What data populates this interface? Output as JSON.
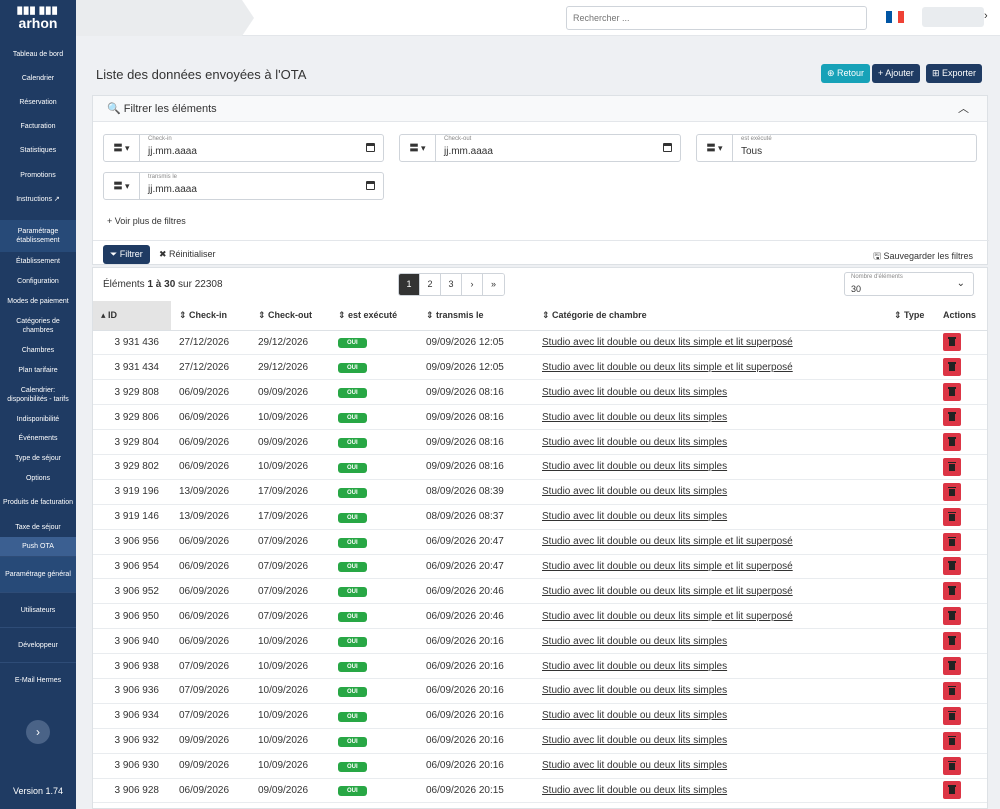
{
  "sidebar": {
    "logo_mark": "▉▉▉ ▉▉▉",
    "logo_name": "arhon",
    "items": [
      {
        "label": "Tableau de bord"
      },
      {
        "label": "Calendrier"
      },
      {
        "label": "Réservation"
      },
      {
        "label": "Facturation"
      },
      {
        "label": "Statistiques"
      },
      {
        "label": "Promotions"
      },
      {
        "label": "Instructions ↗"
      },
      {
        "label": "Paramétrage établissement"
      },
      {
        "label": "Établissement"
      },
      {
        "label": "Configuration"
      },
      {
        "label": "Modes de paiement"
      },
      {
        "label": "Catégories de chambres"
      },
      {
        "label": "Chambres"
      },
      {
        "label": "Plan tarifaire"
      },
      {
        "label": "Calendrier: disponibilités - tarifs"
      },
      {
        "label": "Indisponibilité"
      },
      {
        "label": "Événements"
      },
      {
        "label": "Type de séjour"
      },
      {
        "label": "Options"
      },
      {
        "label": "Produits de facturation"
      },
      {
        "label": "Taxe de séjour"
      },
      {
        "label": "Push OTA"
      },
      {
        "label": "Paramétrage général"
      },
      {
        "label": "Utilisateurs"
      },
      {
        "label": "Développeur"
      },
      {
        "label": "E-Mail Hermes"
      }
    ],
    "collapse_icon": "›",
    "version": "Version 1.74"
  },
  "topbar": {
    "search_placeholder": "Rechercher ...",
    "flag_colors": [
      "#0055a4",
      "#ffffff",
      "#ef4135"
    ],
    "chevron": "›"
  },
  "page": {
    "title": "Liste des données envoyées à l'OTA",
    "btn_retour": "⊕ Retour",
    "btn_ajouter": "+ Ajouter",
    "btn_exporter": "⊞ Exporter"
  },
  "filters": {
    "title": "🔍  Filtrer les éléments",
    "collapse": "︿",
    "op": "〓 ▾",
    "checkin_label": "Check-in",
    "checkin_value": "jj.mm.aaaa",
    "checkout_label": "Check-out",
    "checkout_value": "jj.mm.aaaa",
    "executed_label": "est exécuté",
    "executed_value": "Tous",
    "sent_label": "transmis le",
    "sent_value": "jj.mm.aaaa",
    "more": "+   Voir plus de filtres",
    "btn_filter": "⏷ Filtrer",
    "btn_reset": "✖ Réinitialiser",
    "btn_save": "🖫 Sauvegarder les filtres"
  },
  "table": {
    "count_prefix": "Éléments ",
    "count_range": "1 à 30",
    "count_suffix": " sur 22308",
    "pages": [
      "1",
      "2",
      "3",
      "›",
      "»"
    ],
    "page_size_label": "Nombre d'éléments",
    "page_size_value": "30",
    "page_size_chevron": "⌄",
    "headers": {
      "id": "▴ ID",
      "checkin": "⇕ Check-in",
      "checkout": "⇕ Check-out",
      "executed": "⇕ est exécuté",
      "sent": "⇕ transmis le",
      "category": "⇕ Catégorie de chambre",
      "type": "⇕ Type",
      "actions": "Actions"
    },
    "rows": [
      {
        "id": "3 931 436",
        "checkin": "27/12/2026",
        "checkout": "29/12/2026",
        "executed": "OUI",
        "sent": "09/09/2026 12:05",
        "category": "Studio avec lit double ou deux lits simple et lit superposé",
        "type": ""
      },
      {
        "id": "3 931 434",
        "checkin": "27/12/2026",
        "checkout": "29/12/2026",
        "executed": "OUI",
        "sent": "09/09/2026 12:05",
        "category": "Studio avec lit double ou deux lits simple et lit superposé",
        "type": ""
      },
      {
        "id": "3 929 808",
        "checkin": "06/09/2026",
        "checkout": "09/09/2026",
        "executed": "OUI",
        "sent": "09/09/2026 08:16",
        "category": "Studio avec lit double ou deux lits simples",
        "type": ""
      },
      {
        "id": "3 929 806",
        "checkin": "06/09/2026",
        "checkout": "10/09/2026",
        "executed": "OUI",
        "sent": "09/09/2026 08:16",
        "category": "Studio avec lit double ou deux lits simples",
        "type": ""
      },
      {
        "id": "3 929 804",
        "checkin": "06/09/2026",
        "checkout": "09/09/2026",
        "executed": "OUI",
        "sent": "09/09/2026 08:16",
        "category": "Studio avec lit double ou deux lits simples",
        "type": ""
      },
      {
        "id": "3 929 802",
        "checkin": "06/09/2026",
        "checkout": "10/09/2026",
        "executed": "OUI",
        "sent": "09/09/2026 08:16",
        "category": "Studio avec lit double ou deux lits simples",
        "type": ""
      },
      {
        "id": "3 919 196",
        "checkin": "13/09/2026",
        "checkout": "17/09/2026",
        "executed": "OUI",
        "sent": "08/09/2026 08:39",
        "category": "Studio avec lit double ou deux lits simples",
        "type": ""
      },
      {
        "id": "3 919 146",
        "checkin": "13/09/2026",
        "checkout": "17/09/2026",
        "executed": "OUI",
        "sent": "08/09/2026 08:37",
        "category": "Studio avec lit double ou deux lits simples",
        "type": ""
      },
      {
        "id": "3 906 956",
        "checkin": "06/09/2026",
        "checkout": "07/09/2026",
        "executed": "OUI",
        "sent": "06/09/2026 20:47",
        "category": "Studio avec lit double ou deux lits simple et lit superposé",
        "type": ""
      },
      {
        "id": "3 906 954",
        "checkin": "06/09/2026",
        "checkout": "07/09/2026",
        "executed": "OUI",
        "sent": "06/09/2026 20:47",
        "category": "Studio avec lit double ou deux lits simple et lit superposé",
        "type": ""
      },
      {
        "id": "3 906 952",
        "checkin": "06/09/2026",
        "checkout": "07/09/2026",
        "executed": "OUI",
        "sent": "06/09/2026 20:46",
        "category": "Studio avec lit double ou deux lits simple et lit superposé",
        "type": ""
      },
      {
        "id": "3 906 950",
        "checkin": "06/09/2026",
        "checkout": "07/09/2026",
        "executed": "OUI",
        "sent": "06/09/2026 20:46",
        "category": "Studio avec lit double ou deux lits simple et lit superposé",
        "type": ""
      },
      {
        "id": "3 906 940",
        "checkin": "06/09/2026",
        "checkout": "10/09/2026",
        "executed": "OUI",
        "sent": "06/09/2026 20:16",
        "category": "Studio avec lit double ou deux lits simples",
        "type": ""
      },
      {
        "id": "3 906 938",
        "checkin": "07/09/2026",
        "checkout": "10/09/2026",
        "executed": "OUI",
        "sent": "06/09/2026 20:16",
        "category": "Studio avec lit double ou deux lits simples",
        "type": ""
      },
      {
        "id": "3 906 936",
        "checkin": "07/09/2026",
        "checkout": "10/09/2026",
        "executed": "OUI",
        "sent": "06/09/2026 20:16",
        "category": "Studio avec lit double ou deux lits simples",
        "type": ""
      },
      {
        "id": "3 906 934",
        "checkin": "07/09/2026",
        "checkout": "10/09/2026",
        "executed": "OUI",
        "sent": "06/09/2026 20:16",
        "category": "Studio avec lit double ou deux lits simples",
        "type": ""
      },
      {
        "id": "3 906 932",
        "checkin": "09/09/2026",
        "checkout": "10/09/2026",
        "executed": "OUI",
        "sent": "06/09/2026 20:16",
        "category": "Studio avec lit double ou deux lits simples",
        "type": ""
      },
      {
        "id": "3 906 930",
        "checkin": "09/09/2026",
        "checkout": "10/09/2026",
        "executed": "OUI",
        "sent": "06/09/2026 20:16",
        "category": "Studio avec lit double ou deux lits simples",
        "type": ""
      },
      {
        "id": "3 906 928",
        "checkin": "06/09/2026",
        "checkout": "09/09/2026",
        "executed": "OUI",
        "sent": "06/09/2026 20:15",
        "category": "Studio avec lit double ou deux lits simples",
        "type": ""
      }
    ]
  }
}
